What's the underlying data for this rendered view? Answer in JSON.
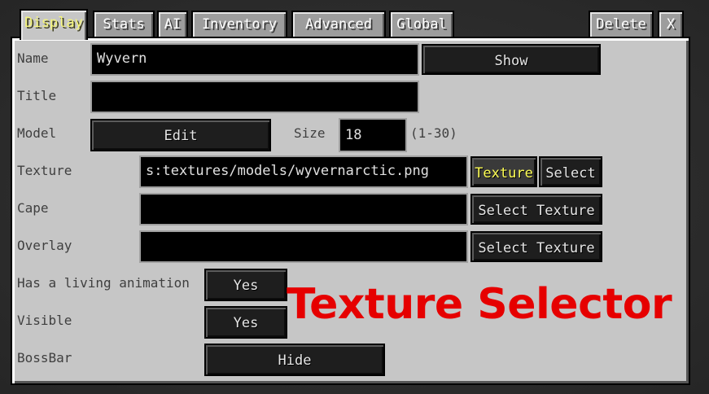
{
  "tabs": [
    {
      "label": "Display",
      "active": true
    },
    {
      "label": "Stats"
    },
    {
      "label": "AI"
    },
    {
      "label": "Inventory"
    },
    {
      "label": "Advanced"
    },
    {
      "label": "Global"
    }
  ],
  "right_tabs": {
    "delete": "Delete",
    "close": "X"
  },
  "form": {
    "name_label": "Name",
    "name_value": "Wyvern",
    "show_button": "Show",
    "title_label": "Title",
    "title_value": "",
    "model_label": "Model",
    "model_edit_button": "Edit",
    "size_label": "Size",
    "size_value": "18",
    "size_range": "(1-30)",
    "texture_label": "Texture",
    "texture_value": "s:textures/models/wyvernarctic.png",
    "texture_button": "Texture",
    "texture_select_button": "Select",
    "cape_label": "Cape",
    "cape_value": "",
    "cape_select_button": "Select Texture",
    "overlay_label": "Overlay",
    "overlay_value": "",
    "overlay_select_button": "Select Texture",
    "living_animation_label": "Has a living animation",
    "living_animation_value": "Yes",
    "visible_label": "Visible",
    "visible_value": "Yes",
    "bossbar_label": "BossBar",
    "bossbar_value": "Hide"
  },
  "caption": "Texture Selector",
  "colors": {
    "panel": "#c6c6c6",
    "active_tab_text": "#f5f57a",
    "highlight_button_text": "#ffff55",
    "caption": "#e60000"
  }
}
